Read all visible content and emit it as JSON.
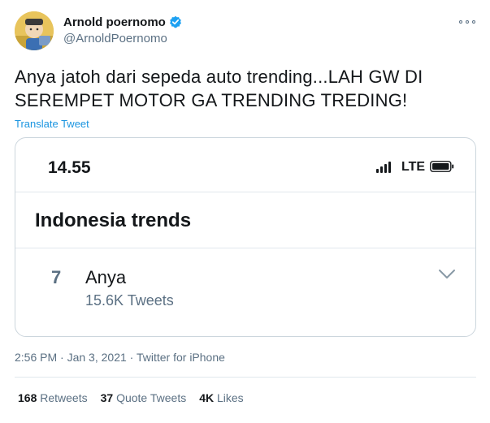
{
  "author": {
    "display_name": "Arnold poernomo",
    "handle": "@ArnoldPoernomo",
    "verified": true
  },
  "more_icon": "more-dots-icon",
  "tweet": {
    "line1": "Anya jatoh dari sepeda auto trending...LAH GW DI",
    "line2": "SEREMPET MOTOR GA TRENDING TREDING!",
    "translate_label": "Translate Tweet"
  },
  "card": {
    "status_time": "14.55",
    "network": "LTE",
    "trends_title": "Indonesia trends",
    "trend": {
      "rank": "7",
      "name": "Anya",
      "count": "15.6K Tweets"
    }
  },
  "meta": {
    "time": "2:56 PM",
    "sep1": " · ",
    "date": "Jan 3, 2021",
    "sep2": " · ",
    "source": "Twitter for iPhone"
  },
  "stats": {
    "retweets_count": "168",
    "retweets_label": " Retweets",
    "quotes_count": "37",
    "quotes_label": " Quote Tweets",
    "likes_count": "4K",
    "likes_label": " Likes"
  },
  "colors": {
    "accent": "#1b95e0",
    "verified": "#1da1f2",
    "secondary_text": "#5b7083",
    "border": "#ccd6dd"
  }
}
